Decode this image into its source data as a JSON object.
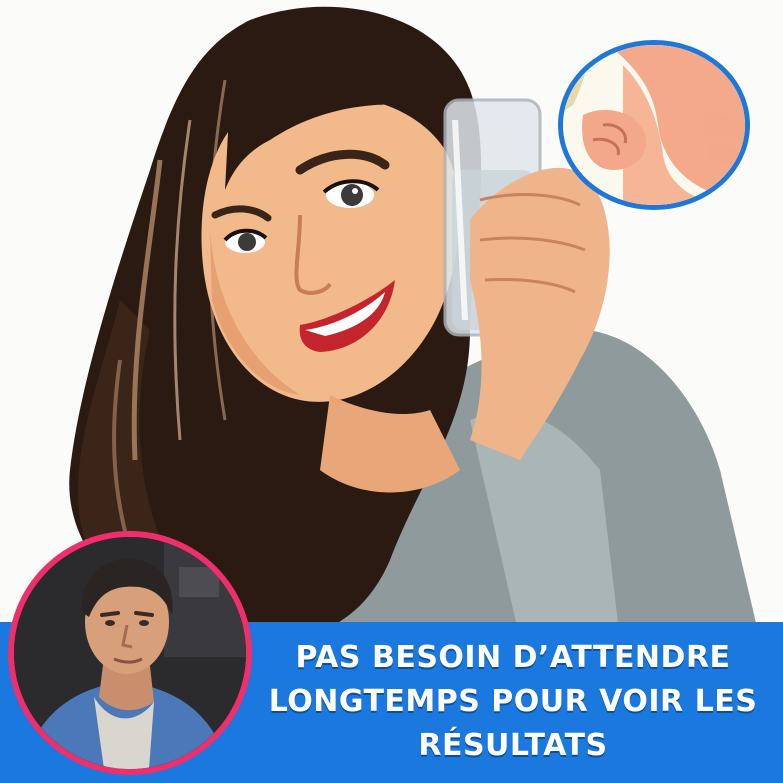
{
  "caption": {
    "text": "PAS BESOIN D’ATTENDRE\nLONGTEMPS POUR VOIR LES\nRÉSULTATS"
  },
  "colors": {
    "banner": "#1a78de",
    "inset_top_border": "#1f78d8",
    "inset_bottom_border": "#ee2f6b",
    "caption_text": "#ffffff"
  },
  "images": {
    "main": "cartoon-woman-drinking-water",
    "inset_top": "hand-pinching-belly-fat",
    "inset_bottom": "man-portrait"
  }
}
